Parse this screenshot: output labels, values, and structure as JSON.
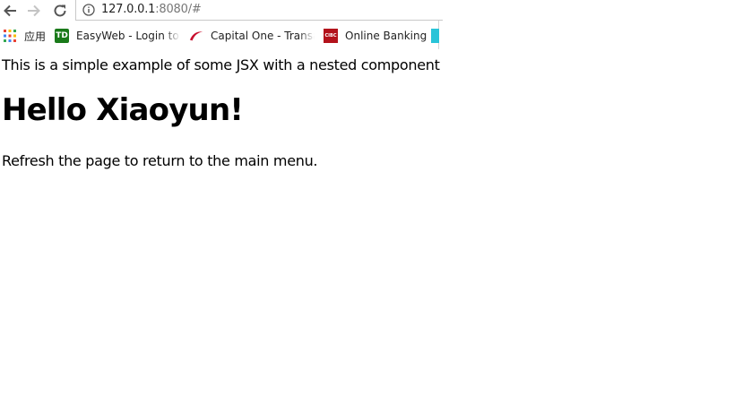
{
  "browser": {
    "address_bar": {
      "host": "127.0.0.1",
      "rest": ":8080/#"
    },
    "bookmarks": [
      {
        "label": "应用",
        "icon": "apps-grid-icon"
      },
      {
        "label": "EasyWeb - Login to o",
        "icon": "td-bank-icon"
      },
      {
        "label": "Capital One - Transac",
        "icon": "capital-one-icon"
      },
      {
        "label": "Online Banking",
        "icon": "cibc-icon"
      }
    ],
    "td_badge_text": "TD",
    "cibc_badge_text": "CIBC"
  },
  "page": {
    "intro": "This is a simple example of some JSX with a nested component",
    "greeting": "Hello Xiaoyun!",
    "refresh_note": "Refresh the page to return to the main menu."
  }
}
